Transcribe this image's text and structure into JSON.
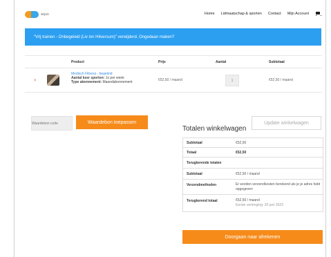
{
  "header": {
    "logo_text": "aquo",
    "nav": [
      "Home",
      "Lidmaatschap & sporten",
      "Contact",
      "Mijn Account"
    ]
  },
  "notice": {
    "message": "“Vrij trainen - Onbegeleid (Liv inn Hilversum)” verwijderd. Ongedaan maken?"
  },
  "cart": {
    "columns": {
      "product": "Product",
      "price": "Prijs",
      "quantity": "Aantal",
      "subtotal": "Subtotaal"
    },
    "item": {
      "remove_symbol": "×",
      "name": "Medisch Fitness - begeleid",
      "sports_label": "Aantal keer sporten:",
      "sports_value": "1x per week",
      "subscription_label": "Type abonnement:",
      "subscription_value": "Maandabonnement",
      "price": "€52,50 / maand",
      "quantity": "1",
      "subtotal": "€52,50 / maand"
    },
    "coupon_placeholder": "Waardebon code",
    "apply_coupon_label": "Waardebon toepassen",
    "update_cart_label": "Update winkelwagen"
  },
  "totals": {
    "title": "Totalen winkelwagen",
    "rows": [
      {
        "label": "Subtotaal",
        "value": "€52,50"
      },
      {
        "label": "Totaal",
        "value": "€52,50"
      },
      {
        "label": "Terugkerende totalen",
        "value": ""
      },
      {
        "label": "Subtotaal",
        "value": "€52,50 / maand"
      },
      {
        "label": "Verzendmethoden",
        "value": "Er worden verzendkosten berekend als je je adres hebt opgegeven"
      },
      {
        "label": "Terugkerend totaal",
        "value": "€52,50 / maand",
        "note": "Eerste verlenging: 20 juni 2023"
      }
    ],
    "checkout_label": "Doorgaan naar afrekenen"
  },
  "colors": {
    "accent_orange": "#f68b1a",
    "notice_blue": "#2c9ff1",
    "link_blue": "#3a8ee0"
  }
}
